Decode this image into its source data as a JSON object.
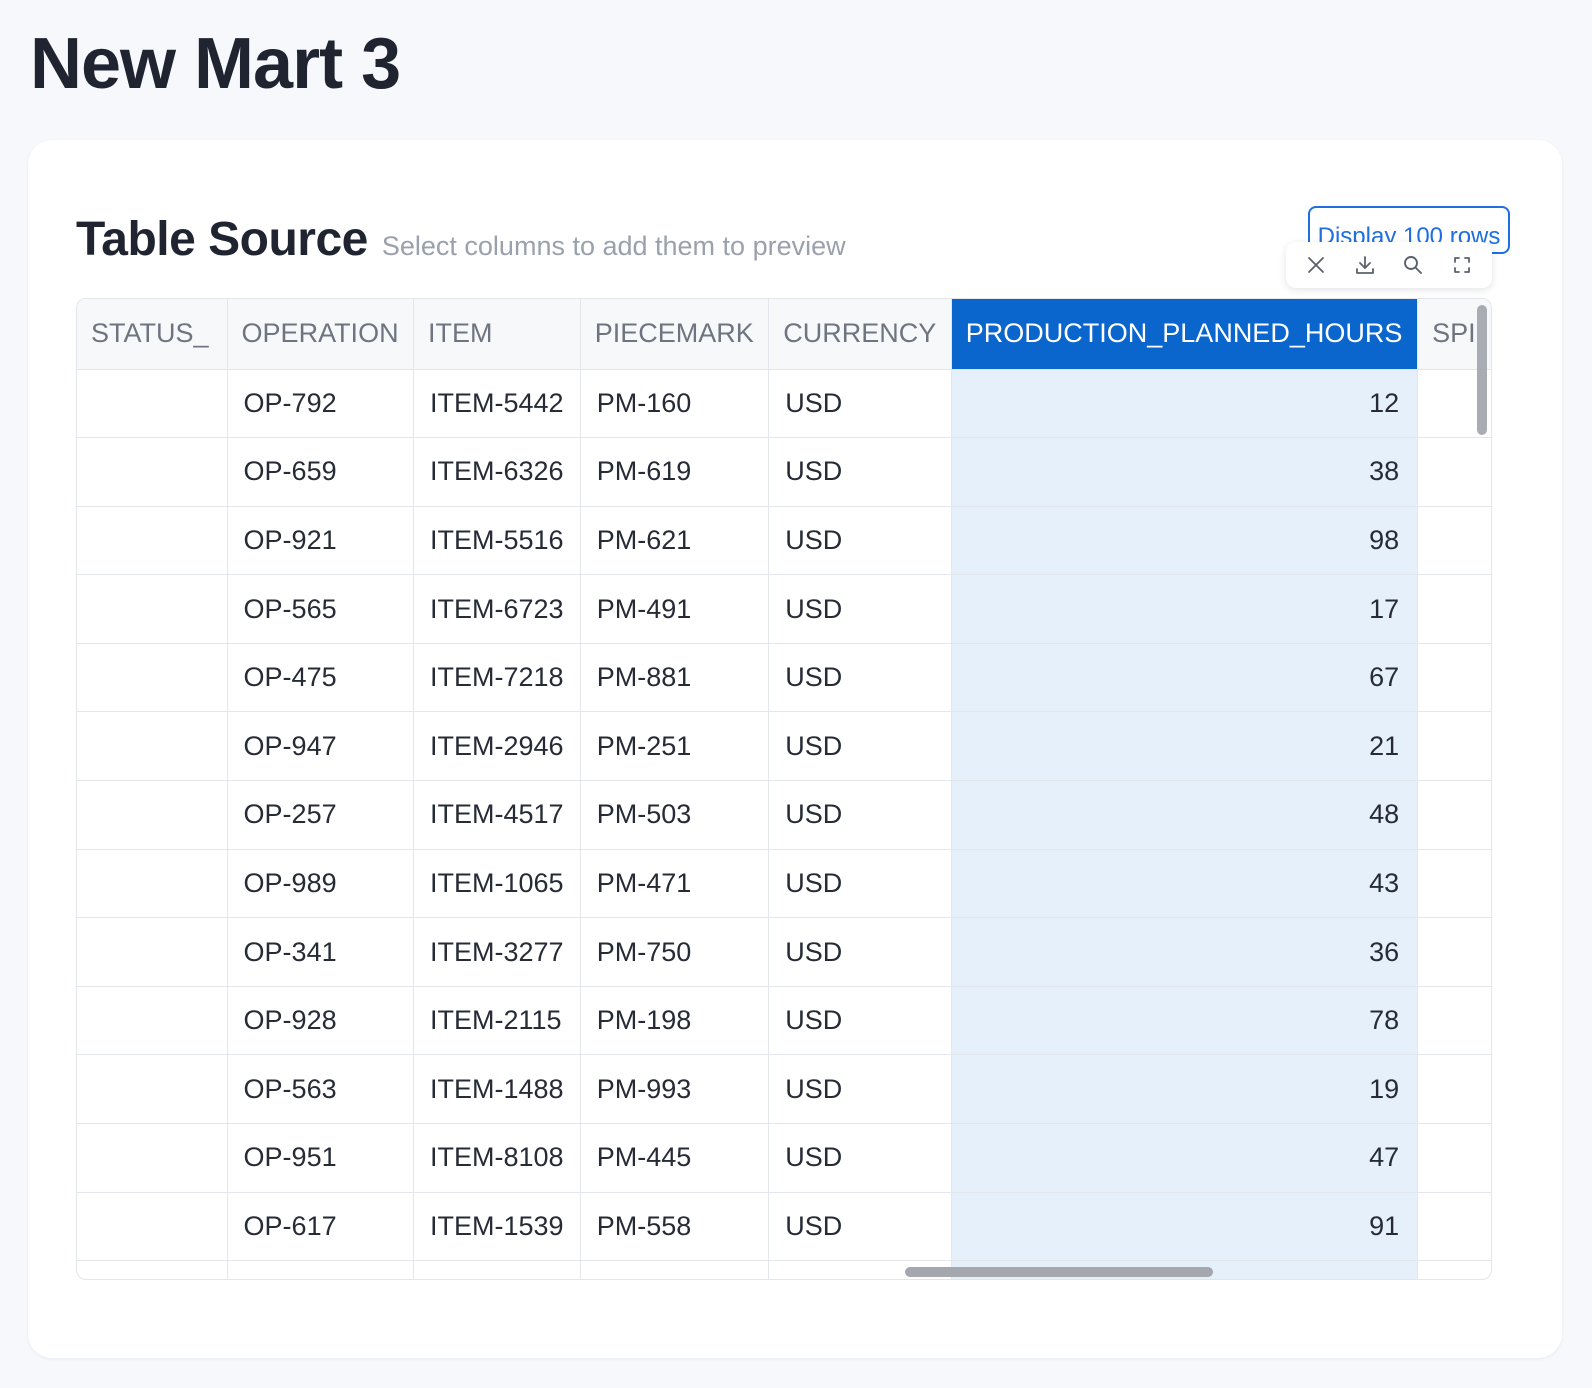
{
  "page": {
    "title": "New Mart 3"
  },
  "card": {
    "title": "Table Source",
    "subtitle": "Select columns to add them to preview",
    "display_rows_label": "Display 100 rows"
  },
  "toolbar": {
    "icons": [
      "close-icon",
      "download-icon",
      "search-icon",
      "fullscreen-icon"
    ]
  },
  "colors": {
    "selected_header_bg": "#0a66cc",
    "selected_cell_bg": "#e6f0fa",
    "button_accent": "#1f6fe0"
  },
  "table": {
    "columns": [
      "_STATUS",
      "OPERATION",
      "ITEM",
      "PIECEMARK",
      "CURRENCY",
      "PRODUCTION_PLANNED_HOURS",
      "SPI"
    ],
    "selected_column": "PRODUCTION_PLANNED_HOURS",
    "rows": [
      [
        "",
        "OP-792",
        "ITEM-5442",
        "PM-160",
        "USD",
        "12",
        ""
      ],
      [
        "",
        "OP-659",
        "ITEM-6326",
        "PM-619",
        "USD",
        "38",
        ""
      ],
      [
        "",
        "OP-921",
        "ITEM-5516",
        "PM-621",
        "USD",
        "98",
        ""
      ],
      [
        "",
        "OP-565",
        "ITEM-6723",
        "PM-491",
        "USD",
        "17",
        ""
      ],
      [
        "",
        "OP-475",
        "ITEM-7218",
        "PM-881",
        "USD",
        "67",
        ""
      ],
      [
        "",
        "OP-947",
        "ITEM-2946",
        "PM-251",
        "USD",
        "21",
        ""
      ],
      [
        "",
        "OP-257",
        "ITEM-4517",
        "PM-503",
        "USD",
        "48",
        ""
      ],
      [
        "",
        "OP-989",
        "ITEM-1065",
        "PM-471",
        "USD",
        "43",
        ""
      ],
      [
        "",
        "OP-341",
        "ITEM-3277",
        "PM-750",
        "USD",
        "36",
        ""
      ],
      [
        "",
        "OP-928",
        "ITEM-2115",
        "PM-198",
        "USD",
        "78",
        ""
      ],
      [
        "",
        "OP-563",
        "ITEM-1488",
        "PM-993",
        "USD",
        "19",
        ""
      ],
      [
        "",
        "OP-951",
        "ITEM-8108",
        "PM-445",
        "USD",
        "47",
        ""
      ],
      [
        "",
        "OP-617",
        "ITEM-1539",
        "PM-558",
        "USD",
        "91",
        ""
      ],
      [
        "",
        "",
        "",
        "",
        "",
        "",
        ""
      ]
    ]
  }
}
